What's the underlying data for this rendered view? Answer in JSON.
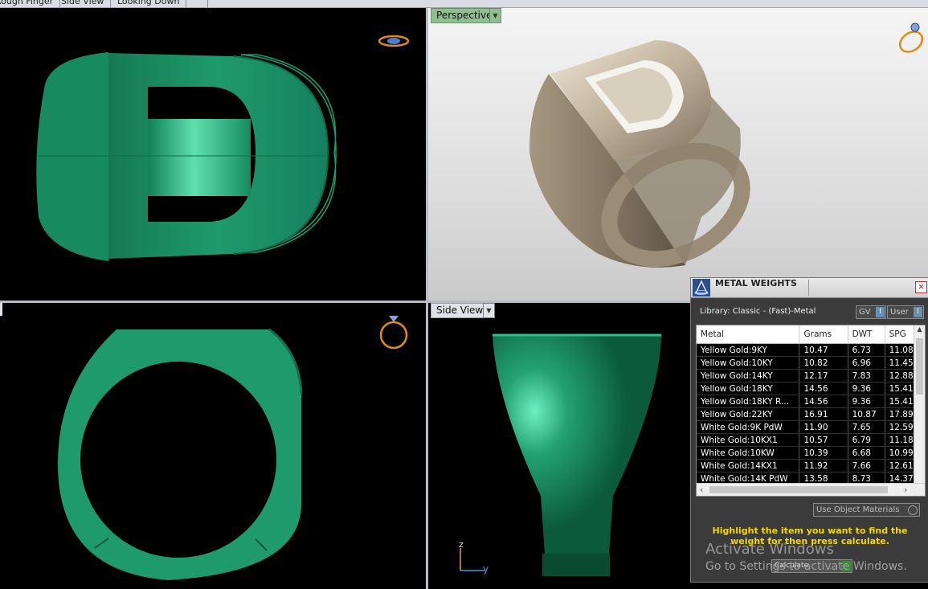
{
  "tabs": [
    "Rough Finger",
    "Side View",
    "Looking Down"
  ],
  "viewports": {
    "perspective_label": "Perspective",
    "side_label": "Side View",
    "axis_z": "z",
    "axis_y": "y"
  },
  "panel": {
    "title": "METAL WEIGHTS",
    "library": "Library: Classic - (Fast)-Metal",
    "gv_label": "GV",
    "user_label": "User",
    "toggle_indicator": "I",
    "columns": [
      "Metal",
      "Grams",
      "DWT",
      "SPG"
    ],
    "rows": [
      {
        "metal": "Yellow Gold:9KY",
        "grams": "10.47",
        "dwt": "6.73",
        "spg": "11.08"
      },
      {
        "metal": "Yellow Gold:10KY",
        "grams": "10.82",
        "dwt": "6.96",
        "spg": "11.45"
      },
      {
        "metal": "Yellow Gold:14KY",
        "grams": "12.17",
        "dwt": "7.83",
        "spg": "12.88"
      },
      {
        "metal": "Yellow Gold:18KY",
        "grams": "14.56",
        "dwt": "9.36",
        "spg": "15.41"
      },
      {
        "metal": "Yellow Gold:18KY R...",
        "grams": "14.56",
        "dwt": "9.36",
        "spg": "15.41"
      },
      {
        "metal": "Yellow Gold:22KY",
        "grams": "16.91",
        "dwt": "10.87",
        "spg": "17.89"
      },
      {
        "metal": "White Gold:9K PdW",
        "grams": "11.90",
        "dwt": "7.65",
        "spg": "12.59"
      },
      {
        "metal": "White Gold:10KX1",
        "grams": "10.57",
        "dwt": "6.79",
        "spg": "11.18"
      },
      {
        "metal": "White Gold:10KW",
        "grams": "10.39",
        "dwt": "6.68",
        "spg": "10.99"
      },
      {
        "metal": "White Gold:14KX1",
        "grams": "11.92",
        "dwt": "7.66",
        "spg": "12.61"
      },
      {
        "metal": "White Gold:14K PdW",
        "grams": "13.58",
        "dwt": "8.73",
        "spg": "14.37"
      }
    ],
    "use_object_materials": "Use Object Materials",
    "hint": "Highlight the item you want to find the weight for then press calculate.",
    "calculate": "Calculate"
  },
  "watermark": {
    "line1": "Activate Windows",
    "line2": "Go to Settings to activate Windows."
  },
  "colors": {
    "ring_green": "#1f9a6c",
    "ring_metal": "#c8bba5",
    "hint_yellow": "#f5d800"
  }
}
